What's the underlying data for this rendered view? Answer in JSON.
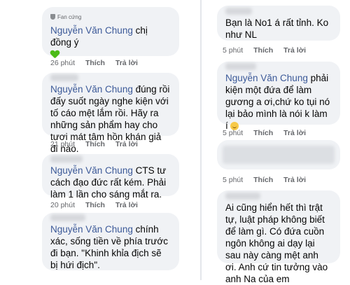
{
  "left": {
    "comments": [
      {
        "badge": "Fan cứng",
        "author": "Nguyễn Văn Chung",
        "text": "chị đồng ý",
        "time": "26 phút",
        "like": "Thích",
        "reply": "Trả lời"
      },
      {
        "author": "Nguyễn Văn Chung",
        "text": "đúng rồi đấy suốt ngày nghe kiện với tố cáo mệt lắm rồi. Hãy ra những sản phẩm hay cho tươi mát tâm hồn khán giả đi nào.",
        "time": "21 phút",
        "like": "Thích",
        "reply": "Trả lời"
      },
      {
        "author": "Nguyễn Văn Chung",
        "text": "CTS tư cách đạo đức rất kém. Phải làm 1 lần cho sáng mắt ra.",
        "time": "20 phút",
        "like": "Thích",
        "reply": "Trả lời"
      },
      {
        "author": "Nguyễn Văn Chung",
        "text": "chính xác, sống tiền về phía trước đi bạn. \"Khinh khỉa địch sẽ bị hứi địch\".",
        "time": ""
      }
    ]
  },
  "right": {
    "comments": [
      {
        "text": "Bạn là No1 á rất tỉnh. Ko như NL",
        "time": "5 phút",
        "like": "Thích",
        "reply": "Trả lời"
      },
      {
        "author": "Nguyễn Văn Chung",
        "text": "phải kiện một đứa để làm gương a ơi,chứ ko tụi nó lại bảo mình là nói k làm í",
        "time": "5 phút",
        "like": "Thích",
        "reply": "Trả lời"
      },
      {
        "text": "",
        "time": "5 phút",
        "like": "Thích",
        "reply": "Trả lời"
      },
      {
        "text": "Ai cũng hiển hết thì trật tự, luật pháp không biết để làm gì. Có đứa cuồn ngôn không ai dạy lại sau này càng mệt anh ơi. Anh cứ tin tưởng vào anh Na của em",
        "time": ""
      }
    ]
  },
  "colors": {
    "bubble": "#f0f2f5",
    "author": "#3b5998",
    "meta": "#65676b",
    "heart": "#4cbb17"
  }
}
